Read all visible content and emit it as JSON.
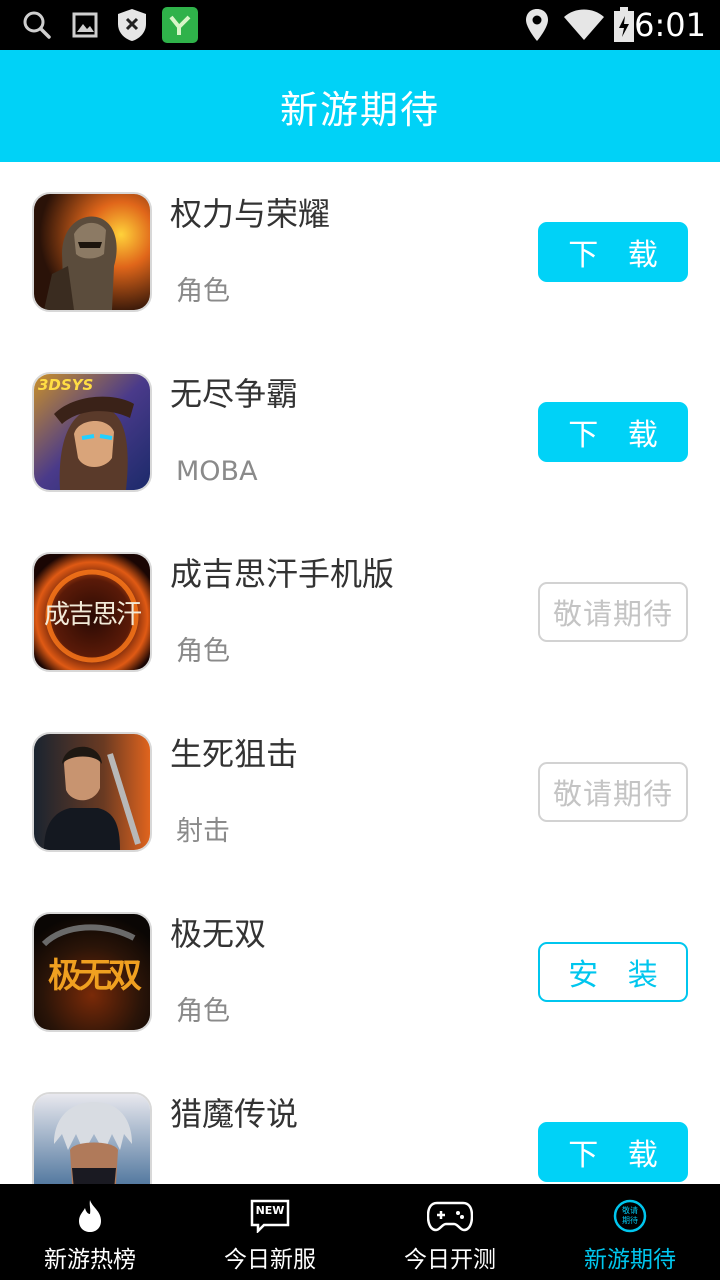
{
  "status_bar": {
    "time": "6:01",
    "icons": [
      "search-icon",
      "image-icon",
      "shield-close-icon",
      "app-y-icon",
      "location-icon",
      "wifi-icon",
      "battery-charging-icon"
    ]
  },
  "header": {
    "title": "新游期待"
  },
  "games": [
    {
      "title": "权力与荣耀",
      "genre": "角色",
      "action": "下 载",
      "action_type": "download",
      "icon": "game-icon-power-glory"
    },
    {
      "title": "无尽争霸",
      "genre": "MOBA",
      "action": "下 载",
      "action_type": "download",
      "icon": "game-icon-endless-hegemony",
      "icon_badge": "3DSYS"
    },
    {
      "title": "成吉思汗手机版",
      "genre": "角色",
      "action": "敬请期待",
      "action_type": "pending",
      "icon": "game-icon-genghis-khan",
      "icon_text": "成吉思汗"
    },
    {
      "title": "生死狙击",
      "genre": "射击",
      "action": "敬请期待",
      "action_type": "pending",
      "icon": "game-icon-sniper"
    },
    {
      "title": "极无双",
      "genre": "角色",
      "action": "安 装",
      "action_type": "install",
      "icon": "game-icon-ji-wushuang",
      "icon_text": "极无双"
    },
    {
      "title": "猎魔传说",
      "genre": "",
      "action": "下 载",
      "action_type": "download",
      "icon": "game-icon-demon-hunter"
    }
  ],
  "bottom_nav": {
    "items": [
      {
        "label": "新游热榜",
        "icon": "flame-icon",
        "active": false
      },
      {
        "label": "今日新服",
        "icon": "new-badge-icon",
        "icon_text": "NEW",
        "active": false
      },
      {
        "label": "今日开测",
        "icon": "gamepad-icon",
        "active": false
      },
      {
        "label": "新游期待",
        "icon": "anticipate-icon",
        "icon_text": "敬请期待",
        "active": true
      }
    ]
  },
  "colors": {
    "accent": "#00d2f7",
    "active_nav": "#00c6ee",
    "pending_text": "#c4c4c4"
  }
}
